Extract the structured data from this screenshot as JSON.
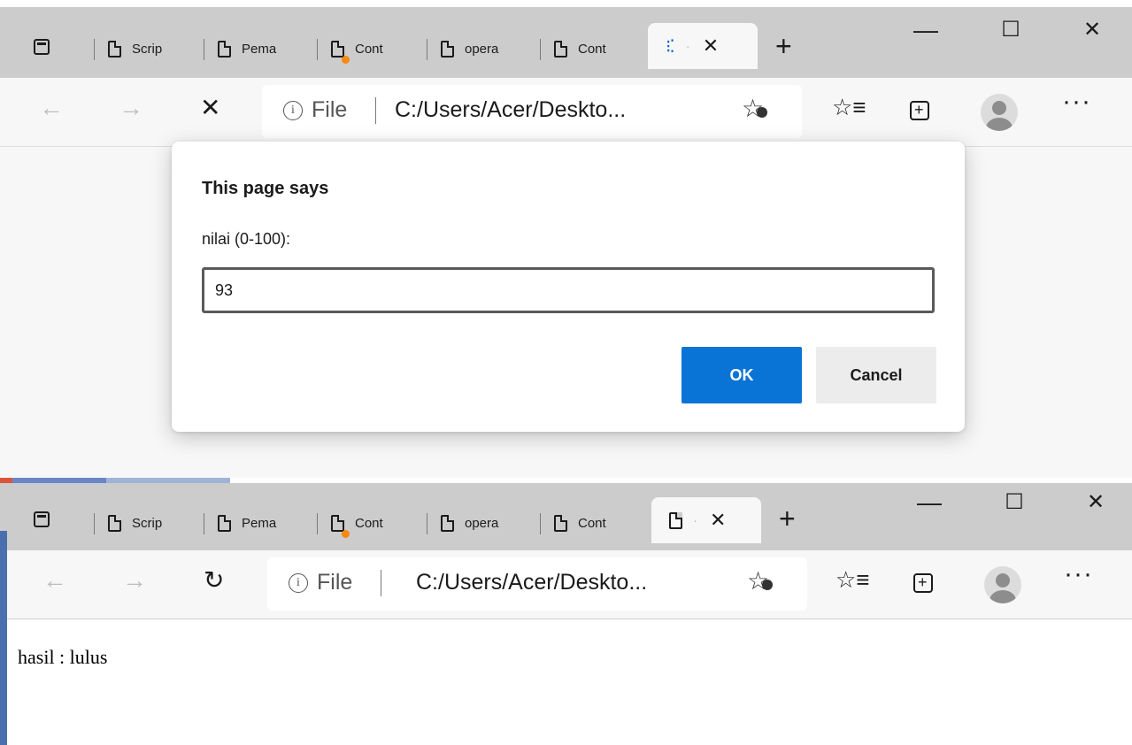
{
  "window1": {
    "tabs": [
      {
        "label": "Scrip"
      },
      {
        "label": "Pema"
      },
      {
        "label": "Cont",
        "notification": true
      },
      {
        "label": "opera"
      },
      {
        "label": "Cont"
      }
    ],
    "active_tab": {
      "state": "loading"
    },
    "toolbar": {
      "back_icon": "←",
      "forward_icon": "→",
      "stop_icon": "✕"
    },
    "address": {
      "scheme_label": "File",
      "url": "C:/Users/Acer/Deskto..."
    },
    "dialog": {
      "title": "This page says",
      "message": "nilai (0-100):",
      "input_value": "93",
      "ok_label": "OK",
      "cancel_label": "Cancel"
    }
  },
  "window2": {
    "tabs": [
      {
        "label": "Scrip"
      },
      {
        "label": "Pema"
      },
      {
        "label": "Cont",
        "notification": true
      },
      {
        "label": "opera"
      },
      {
        "label": "Cont"
      }
    ],
    "toolbar": {
      "back_icon": "←",
      "forward_icon": "→",
      "reload_icon": "↻"
    },
    "address": {
      "scheme_label": "File",
      "url": "C:/Users/Acer/Deskto..."
    },
    "page": {
      "result_text": "hasil : lulus"
    }
  },
  "colors": {
    "accent": "#0a74d6",
    "notification_dot": "#f7890d",
    "tabstrip": "#cccccc"
  }
}
